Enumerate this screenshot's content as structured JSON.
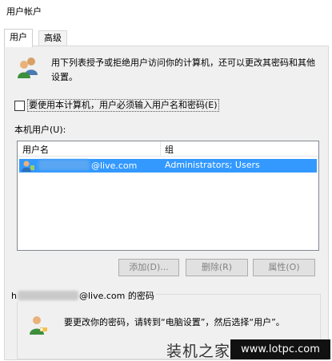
{
  "window": {
    "title": "用户帐户"
  },
  "tabs": [
    {
      "label": "用户"
    },
    {
      "label": "高级"
    }
  ],
  "intro": {
    "text": "用下列表授予或拒绝用户访问你的计算机，还可以更改其密码和其他设置。"
  },
  "require_login": {
    "label": "要使用本计算机，用户必须输入用户名和密码(E)",
    "checked": false
  },
  "local_users_label": "本机用户(U):",
  "table": {
    "columns": [
      "用户名",
      "组"
    ],
    "rows": [
      {
        "user_suffix": "@live.com",
        "group": "Administrators; Users",
        "selected": true
      }
    ]
  },
  "buttons": {
    "add": "添加(D)...",
    "remove": "删除(R)",
    "properties": "属性(O)"
  },
  "password_group": {
    "prefix": "h",
    "suffix": "@live.com 的密码",
    "text": "要更改你的密码，请转到“电脑设置”，然后选择“用户”。"
  },
  "watermark": {
    "brand": "装机之家",
    "url": "www.lotpc.com"
  },
  "colors": {
    "selection": "#3399ff",
    "panel": "#f0f0f0"
  }
}
